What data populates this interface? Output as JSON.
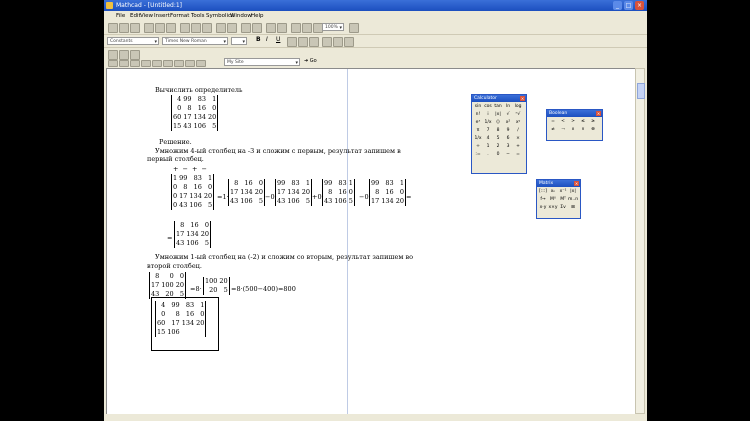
{
  "window": {
    "title": "Mathcad - [Untitled:1]",
    "controls": {
      "minimize": "_",
      "restore": "□",
      "close": "×"
    }
  },
  "menu": [
    "File",
    "Edit",
    "View",
    "Insert",
    "Format",
    "Tools",
    "Symbolics",
    "Window",
    "Help"
  ],
  "toolbar": {
    "zoom": "100%",
    "style_select": "Constants",
    "font_select": "Times New Roman",
    "bold": "B",
    "italic": "I",
    "underline": "U",
    "resource_select": "My Site",
    "go_label": "Go"
  },
  "document": {
    "heading": "Вычислить определитель",
    "main_matrix": [
      [
        "4",
        "99",
        "83",
        "1"
      ],
      [
        "0",
        "8",
        "16",
        "0"
      ],
      [
        "60",
        "17",
        "134",
        "20"
      ],
      [
        "15",
        "43",
        "106",
        "5"
      ]
    ],
    "solution_label": "Решение.",
    "step1_text_1": "Умножим 4-ый столбец на -3 и сложим с первым, результат запишем в",
    "step1_text_2": "первый столбец.",
    "signs": "+   −   +   −",
    "step1_matrix": [
      [
        "1",
        "99",
        "83",
        "1"
      ],
      [
        "0",
        "8",
        "16",
        "0"
      ],
      [
        "0",
        "17",
        "134",
        "20"
      ],
      [
        "0",
        "43",
        "106",
        "5"
      ]
    ],
    "eq1": "=1·",
    "minor1": [
      [
        "8",
        "16",
        "0"
      ],
      [
        "17",
        "134",
        "20"
      ],
      [
        "43",
        "106",
        "5"
      ]
    ],
    "op_after_minor1": "−0·",
    "minor2": [
      [
        "99",
        "83",
        "1"
      ],
      [
        "17",
        "134",
        "20"
      ],
      [
        "43",
        "106",
        "5"
      ]
    ],
    "op_after_minor2": "+0·",
    "minor3": [
      [
        "99",
        "83",
        "1"
      ],
      [
        "8",
        "16",
        "0"
      ],
      [
        "43",
        "106",
        "5"
      ]
    ],
    "op_after_minor3": "−0·",
    "minor4": [
      [
        "99",
        "83",
        "1"
      ],
      [
        "8",
        "16",
        "0"
      ],
      [
        "17",
        "134",
        "20"
      ]
    ],
    "eq_end": "=",
    "result_prefix": "=",
    "result_matrix": [
      [
        "8",
        "16",
        "0"
      ],
      [
        "17",
        "134",
        "20"
      ],
      [
        "43",
        "106",
        "5"
      ]
    ],
    "step2_text_1": "Умножим 1-ый столбец на (-2) и сложим со вторым, результат запишем во",
    "step2_text_2": "второй столбец.",
    "step2_matrix": [
      [
        "8",
        "0",
        "0"
      ],
      [
        "17",
        "100",
        "20"
      ],
      [
        "43",
        "20",
        "5"
      ]
    ],
    "step2_mid": "=8·",
    "step2_small": [
      [
        "100",
        "20"
      ],
      [
        "20",
        "5"
      ]
    ],
    "step2_result": "=8·(500−400)=800",
    "edit_matrix": [
      [
        "4",
        "99",
        "83",
        "1"
      ],
      [
        "0",
        "8",
        "16",
        "0"
      ],
      [
        "60",
        "17",
        "134",
        "20"
      ],
      [
        "15",
        "106",
        "",
        ""
      ]
    ]
  },
  "palettes": {
    "calculator": {
      "title": "Calculator",
      "keys": [
        "sin",
        "cos",
        "tan",
        "ln",
        "log",
        "n!",
        "i",
        "|x|",
        "√",
        "ⁿ√",
        "eˣ",
        "1/x",
        "()",
        "x²",
        "xʸ",
        "π",
        "7",
        "8",
        "9",
        "/",
        "1/x",
        "4",
        "5",
        "6",
        "×",
        "÷",
        "1",
        "2",
        "3",
        "+",
        ":=",
        ".",
        "0",
        "−",
        "="
      ]
    },
    "boolean": {
      "title": "Boolean",
      "keys": [
        "=",
        "<",
        ">",
        "≤",
        "≥",
        "≠",
        "¬",
        "∧",
        "∨",
        "⊕"
      ]
    },
    "matrix": {
      "title": "Matrix",
      "keys": [
        "[:::]",
        "xₙ",
        "x⁻¹",
        "|x|",
        "f→",
        "M⁽⁾",
        "Mᵀ",
        "m..n",
        "x·y",
        "x×y",
        "Σv",
        "⊞"
      ]
    }
  }
}
